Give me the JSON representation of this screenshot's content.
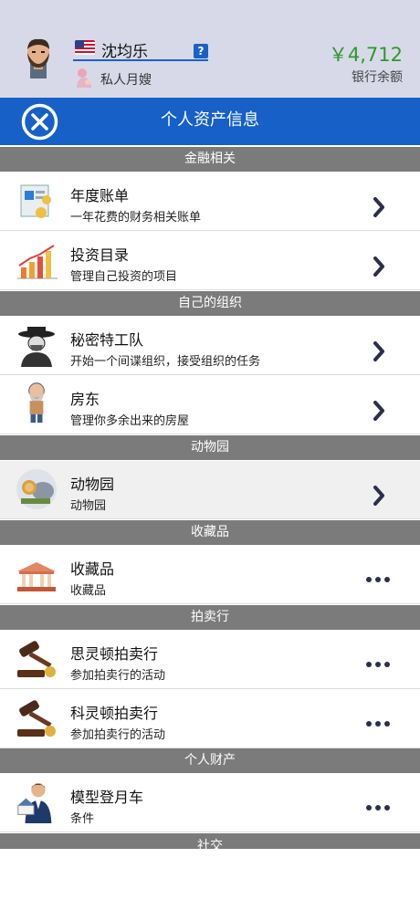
{
  "header": {
    "player_name": "沈均乐",
    "help_label": "?",
    "occupation": "私人月嫂",
    "balance": "￥4,712",
    "balance_label": "银行余额"
  },
  "titlebar": {
    "title": "个人资产信息"
  },
  "sections": {
    "finance": "金融相关",
    "org": "自己的组织",
    "zoo": "动物园",
    "collect": "收藏品",
    "auction": "拍卖行",
    "property": "个人财产",
    "social": "社交"
  },
  "rows": {
    "bill": {
      "title": "年度账单",
      "subtitle": "一年花费的财务相关账单"
    },
    "invest": {
      "title": "投资目录",
      "subtitle": "管理自己投资的项目"
    },
    "spy": {
      "title": "秘密特工队",
      "subtitle": "开始一个间谍组织，接受组织的任务"
    },
    "landlord": {
      "title": "房东",
      "subtitle": "管理你多余出来的房屋"
    },
    "zoo": {
      "title": "动物园",
      "subtitle": "动物园"
    },
    "collection": {
      "title": "收藏品",
      "subtitle": "收藏品"
    },
    "auction1": {
      "title": "思灵顿拍卖行",
      "subtitle": "参加拍卖行的活动"
    },
    "auction2": {
      "title": "科灵顿拍卖行",
      "subtitle": "参加拍卖行的活动"
    },
    "car": {
      "title": "模型登月车",
      "subtitle": "条件"
    }
  },
  "colors": {
    "header_bg": "#d8d9e8",
    "titlebar_bg": "#1660c8",
    "section_bg": "#7b7b7b",
    "balance_green": "#2a9a2a",
    "chevron": "#2b2f4c"
  },
  "icons": {
    "avatar": "bearded-man-avatar",
    "flag": "us-flag-icon",
    "occupation": "nanny-icon",
    "close": "close-circle-icon"
  }
}
